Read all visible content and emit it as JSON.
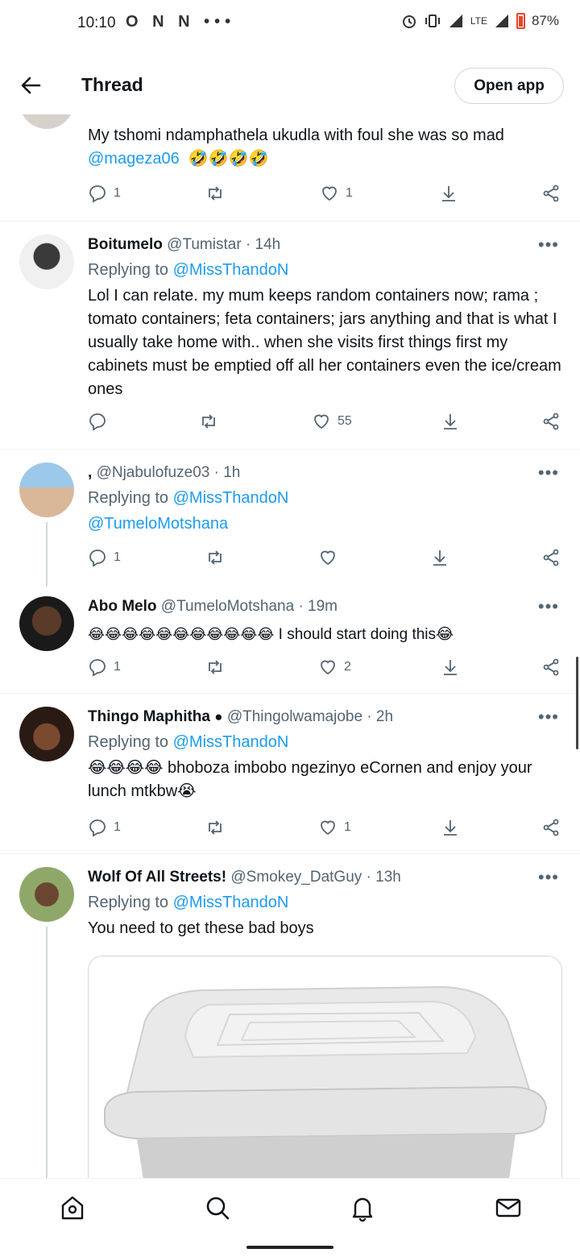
{
  "status_bar": {
    "time": "10:10",
    "notif_icons": "O N N •••",
    "network": "LTE",
    "battery": "87%"
  },
  "header": {
    "title": "Thread",
    "open_app_label": "Open app"
  },
  "tweets": [
    {
      "text": "My tshomi ndamphathela ukudla with foul she was so mad",
      "mention_line": "@mageza06",
      "emoji": "🤣🤣🤣🤣",
      "replies": "1",
      "retweets": "",
      "likes": "1"
    },
    {
      "name": "Boitumelo",
      "handle": "@Tumistar · 14h",
      "replying_prefix": "Replying to",
      "replying_to": "@MissThandoN",
      "text": "Lol I can relate. my mum keeps random containers now; rama ; tomato containers; feta containers; jars anything  and that is what I usually take home with.. when she visits first things first my cabinets must be emptied off all her containers even the ice/cream ones",
      "replies": "",
      "retweets": "",
      "likes": "55"
    },
    {
      "name": ",",
      "handle": "@Njabulofuze03 · 1h",
      "replying_prefix": "Replying to",
      "replying_to": "@MissThandoN",
      "text_mention": "@TumeloMotshana",
      "replies": "1",
      "retweets": "",
      "likes": ""
    },
    {
      "name": "Abo Melo",
      "handle": "@TumeloMotshana · 19m",
      "emoji": "😂😂😂😂😂😂😂😂😂😂😂",
      "text": " I should start doing this😂",
      "replies": "1",
      "retweets": "",
      "likes": "2"
    },
    {
      "name": "Thingo Maphitha ",
      "handle": "@Thingolwamajobe · 2h",
      "replying_prefix": "Replying to",
      "replying_to": "@MissThandoN",
      "text": "😂😂😂😂 bhoboza imbobo ngezinyo eCornen and enjoy your lunch mtkbw😭",
      "replies": "1",
      "retweets": "",
      "likes": "1"
    },
    {
      "name": "Wolf Of All Streets!",
      "handle": "@Smokey_DatGuy · 13h",
      "replying_prefix": "Replying to",
      "replying_to": "@MissThandoN",
      "text": "You need to get these bad boys"
    }
  ],
  "icons": {
    "back": "arrow-left-icon",
    "reply": "reply-icon",
    "retweet": "retweet-icon",
    "like": "heart-icon",
    "share": "share-icon",
    "more": "more-icon"
  },
  "colors": {
    "accent": "#1d9bf0",
    "secondary_text": "#536471",
    "divider": "#eff3f4"
  }
}
